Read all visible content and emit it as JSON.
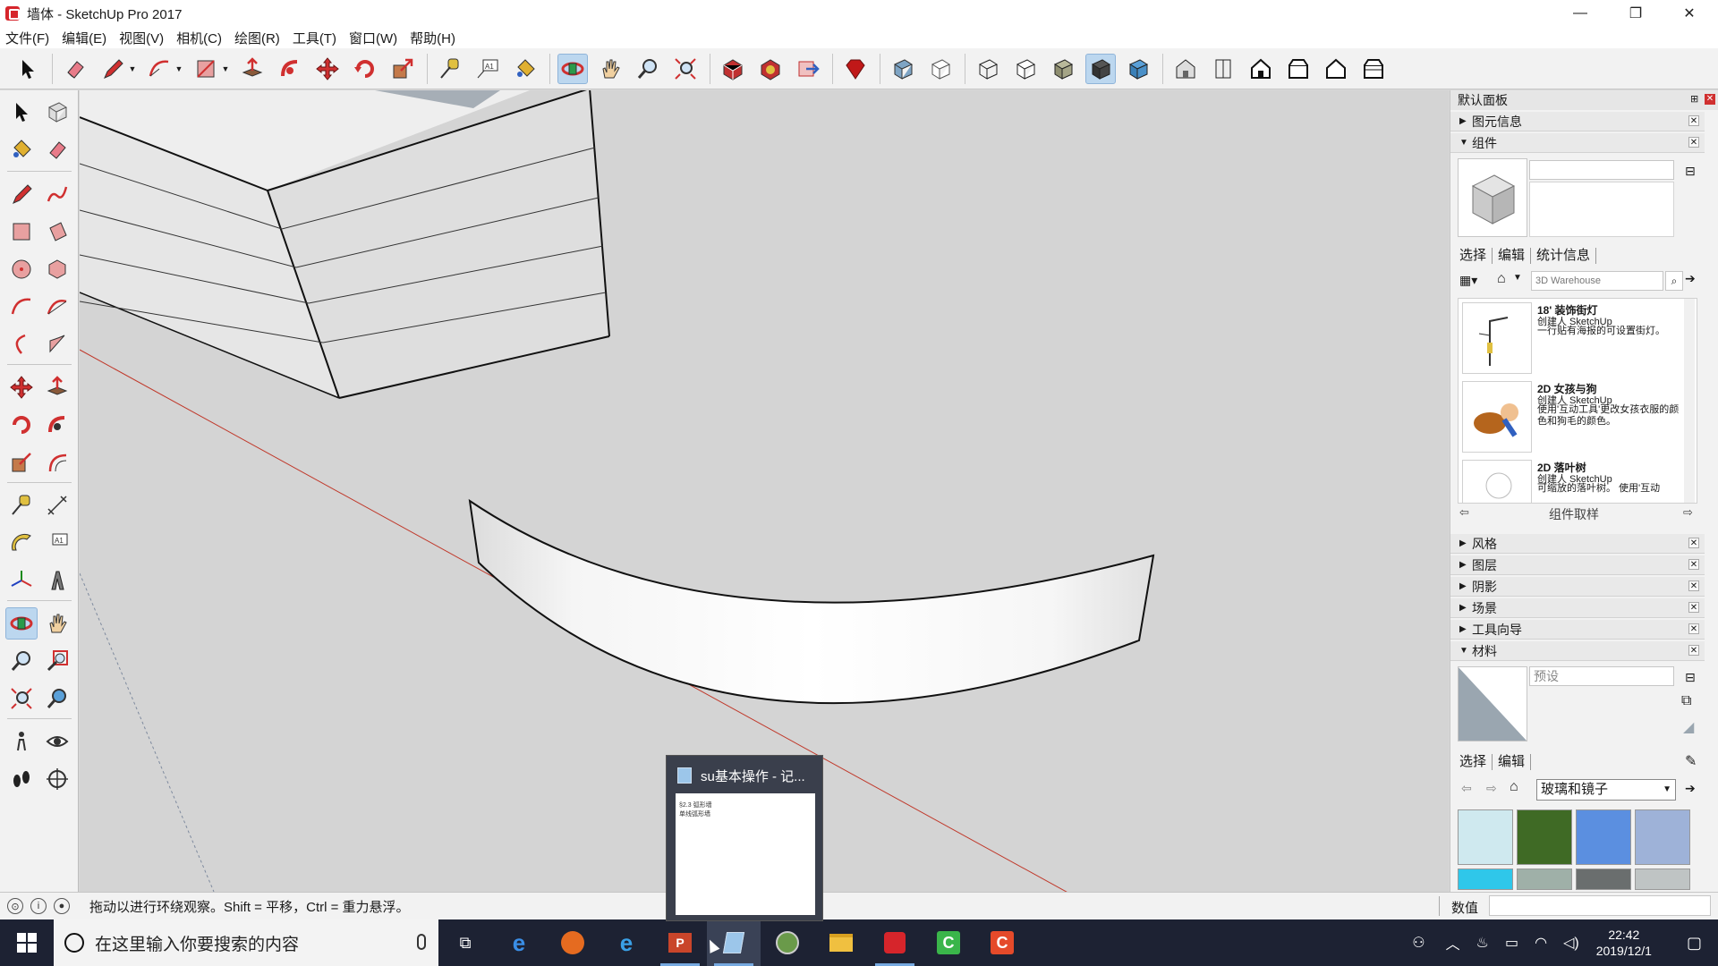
{
  "window": {
    "title": "墙体 - SketchUp Pro 2017",
    "minimize": "—",
    "restore": "❐",
    "close": "✕"
  },
  "menu": [
    "文件(F)",
    "编辑(E)",
    "视图(V)",
    "相机(C)",
    "绘图(R)",
    "工具(T)",
    "窗口(W)",
    "帮助(H)"
  ],
  "status": {
    "hint": "拖动以进行环绕观察。Shift = 平移，Ctrl = 重力悬浮。",
    "measurements_label": "数值"
  },
  "tray": {
    "title": "默认面板",
    "sections_top": [
      {
        "label": "图元信息",
        "expanded": false
      },
      {
        "label": "组件",
        "expanded": true
      }
    ],
    "components": {
      "tabs": [
        "选择",
        "编辑",
        "统计信息"
      ],
      "search_placeholder": "3D Warehouse",
      "items": [
        {
          "name": "18' 装饰街灯",
          "author": "创建人 SketchUp",
          "desc": "一行贴有海报的可设置街灯。"
        },
        {
          "name": "2D 女孩与狗",
          "author": "创建人 SketchUp",
          "desc": "使用'互动工具'更改女孩衣服的颜色和狗毛的颜色。"
        },
        {
          "name": "2D 落叶树",
          "author": "创建人 SketchUp",
          "desc": "可缩放的落叶树。 使用'互动"
        }
      ],
      "sample_label": "组件取样"
    },
    "sections_mid": [
      "风格",
      "图层",
      "阴影",
      "场景",
      "工具向导",
      "材料"
    ],
    "materials": {
      "name_placeholder": "预设",
      "tabs": [
        "选择",
        "编辑"
      ],
      "collection": "玻璃和镜子",
      "swatch_colors": [
        "#cfe9ef",
        "#3f6a25",
        "#5b8fe0",
        "#9eb2d8",
        "#2fc7ea",
        "#9fb0a8",
        "#6a6e6e",
        "#bfc4c4"
      ]
    }
  },
  "taskbar": {
    "search_placeholder": "在这里输入你要搜索的内容",
    "time": "22:42",
    "date": "2019/12/1",
    "thumbnail": {
      "title": "su基本操作 - 记...",
      "lines": [
        "§2.3 弧形墙",
        "单线弧形墙"
      ]
    }
  },
  "colors": {
    "accent": "#bcd7ef",
    "axis_red": "#c0392b",
    "taskbar": "#1d2233"
  }
}
